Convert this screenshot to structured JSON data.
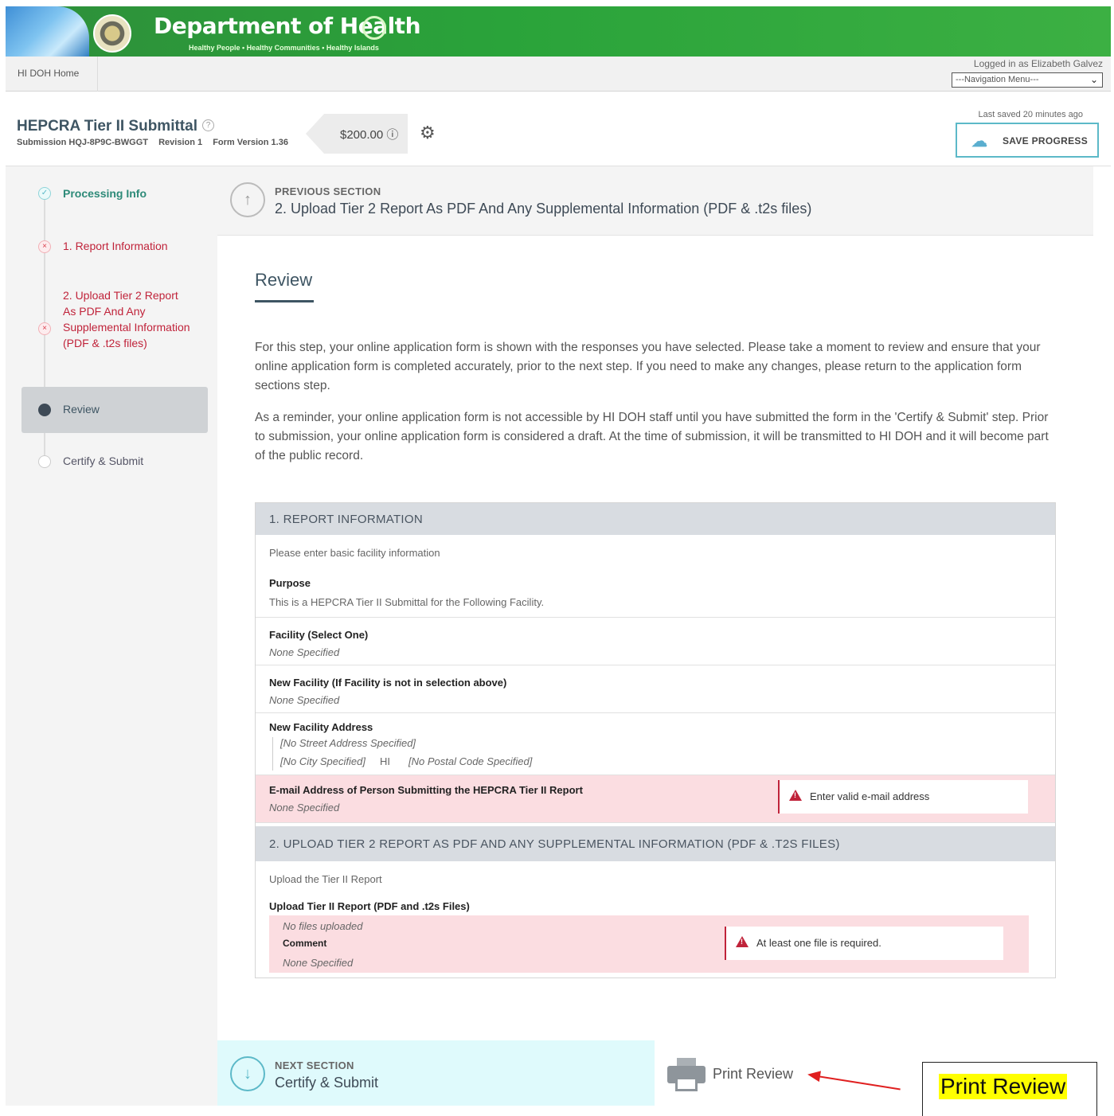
{
  "banner": {
    "title": "Department of Health",
    "tagline": "Healthy People • Healthy Communities • Healthy Islands"
  },
  "topbar": {
    "home_link": "HI DOH Home",
    "logged_in": "Logged in as Elizabeth Galvez",
    "nav_menu": "---Navigation Menu---"
  },
  "submission": {
    "title": "HEPCRA Tier II Submittal",
    "help_icon": "question-circle-icon",
    "submission_id": "Submission HQJ-8P9C-BWGGT",
    "revision": "Revision 1",
    "form_version": "Form Version 1.36",
    "fee": "$200.00 ⓘ",
    "last_saved": "Last saved 20 minutes ago",
    "save_label": "SAVE PROGRESS"
  },
  "sidebar": {
    "steps": [
      {
        "label": "Processing Info",
        "status": "done"
      },
      {
        "label": "1. Report Information",
        "status": "error"
      },
      {
        "label": "2. Upload Tier 2 Report As PDF And Any Supplemental Information (PDF & .t2s files)",
        "status": "error"
      },
      {
        "label": "Review",
        "status": "active"
      },
      {
        "label": "Certify & Submit",
        "status": "todo"
      }
    ]
  },
  "previous_section": {
    "label": "PREVIOUS SECTION",
    "name": "2. Upload Tier 2 Report As PDF And Any Supplemental Information (PDF & .t2s files)"
  },
  "review": {
    "title": "Review",
    "para1": "For this step, your online application form is shown with the responses you have selected. Please take a moment to review and ensure that your online application form is completed accurately, prior to the next step. If you need to make any changes, please return to the application form sections step.",
    "para2": "As a reminder, your online application form is not accessible by HI DOH staff until you have submitted the form in the 'Certify & Submit' step. Prior to submission, your online application form is considered a draft. At the time of submission, it will be transmitted to HI DOH and it will become part of the public record."
  },
  "section1": {
    "header": "1. REPORT INFORMATION",
    "intro": "Please enter basic facility information",
    "purpose_label": "Purpose",
    "purpose_value": "This is a HEPCRA Tier II Submittal for the Following Facility.",
    "facility_label": "Facility (Select One)",
    "facility_value": "None Specified",
    "new_facility_label": "New Facility (If Facility is not in selection above)",
    "new_facility_value": "None Specified",
    "address_label": "New Facility Address",
    "address_street": "[No Street Address Specified]",
    "address_city": "[No City Specified]",
    "address_state": "HI",
    "address_postal": "[No Postal Code Specified]",
    "email_label": "E-mail Address of Person Submitting the HEPCRA Tier II Report",
    "email_value": "None Specified",
    "email_error": "Enter valid e-mail address"
  },
  "section2": {
    "header": "2. UPLOAD TIER 2 REPORT AS PDF AND ANY SUPPLEMENTAL INFORMATION (PDF & .T2S FILES)",
    "intro": "Upload the Tier II Report",
    "upload_label": "Upload Tier II Report (PDF and .t2s Files)",
    "files_value": "No files uploaded",
    "comment_label": "Comment",
    "comment_value": "None Specified",
    "files_error": "At least one file is required."
  },
  "next_section": {
    "label": "NEXT SECTION",
    "name": "Certify & Submit"
  },
  "print": {
    "label": "Print Review"
  },
  "annotation": {
    "callout": "Print Review",
    "arrow_color": "#e02020",
    "highlight_color": "#ffff00"
  }
}
